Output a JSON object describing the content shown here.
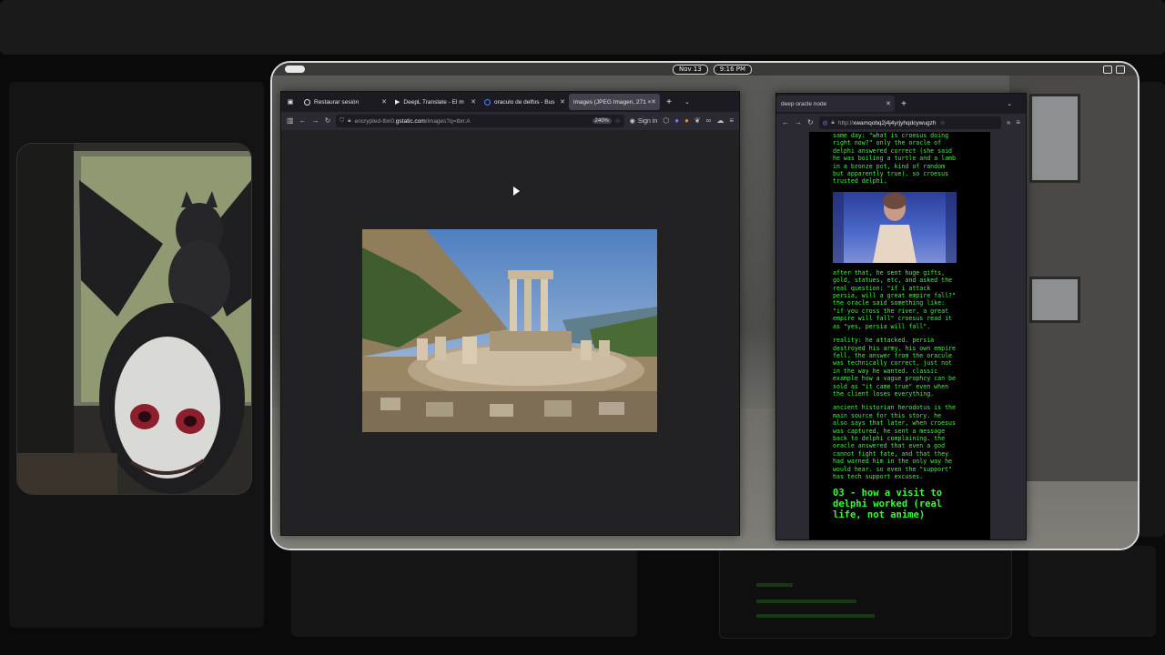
{
  "topbar": {
    "date": "Nov 13",
    "time": "9:16 PM"
  },
  "browser_main": {
    "tabs": [
      {
        "label": "Restaurar sesión",
        "icon": "restore-icon"
      },
      {
        "label": "DeepL Translate - El m",
        "icon": "deepl-icon"
      },
      {
        "label": "oraculo de delfos - Bus",
        "icon": "google-icon"
      },
      {
        "label": "images (JPEG Imagen, 271 ×",
        "icon": "image-icon"
      }
    ],
    "url_prefix": "encrypted-tbn0.",
    "url_host": "gstatic.com",
    "url_path": "/images?q=tbn:A",
    "zoom": "240%",
    "sign_in": "Sign in"
  },
  "browser_side": {
    "tab": "deep oracle node",
    "url_prefix": "http://",
    "url_host": "xwamqobq2j4j4yrjyhqdcywugzh",
    "article": {
      "p1": "same day: \"what is croesus doing\nright now?\" only the oracle of\ndelphi answered correct (she said\nhe was boiling a turtle and a lamb\nin a bronze pot, kind of random\nbut apparently true). so croesus\ntrusted delphi.",
      "p2": "after that, he sent huge gifts,\ngold, statues, etc, and asked the\nreal question: \"if i attack\npersia, will a great empire fall?\"\nthe oracle said something like:\n\"if you cross the river, a great\nempire will fall\" croesus read it\nas \"yes, persia will fall\".",
      "p3": "reality: he attacked. persia\ndestroyed his army. his own empire\nfell. the answer from the oracule\nwas technically correct, just not\nin the way he wanted. classic\nexample how a vague prophcy can be\nsold as \"it came true\" even when\nthe client loses everything.",
      "p4": "ancient historian herodotus is the\nmain source for this story. he\nalso says that later, when croesus\nwas captured, he sent a message\nback to delphi complaining. the\noracle answered that even a god\ncannot fight fate, and that they\nhad warned him in the only way he\nwould hear. so even the \"support\"\nhas tech support excuses.",
      "heading": "03 - how a visit to\ndelphi worked (real\nlife, not anime)"
    }
  }
}
